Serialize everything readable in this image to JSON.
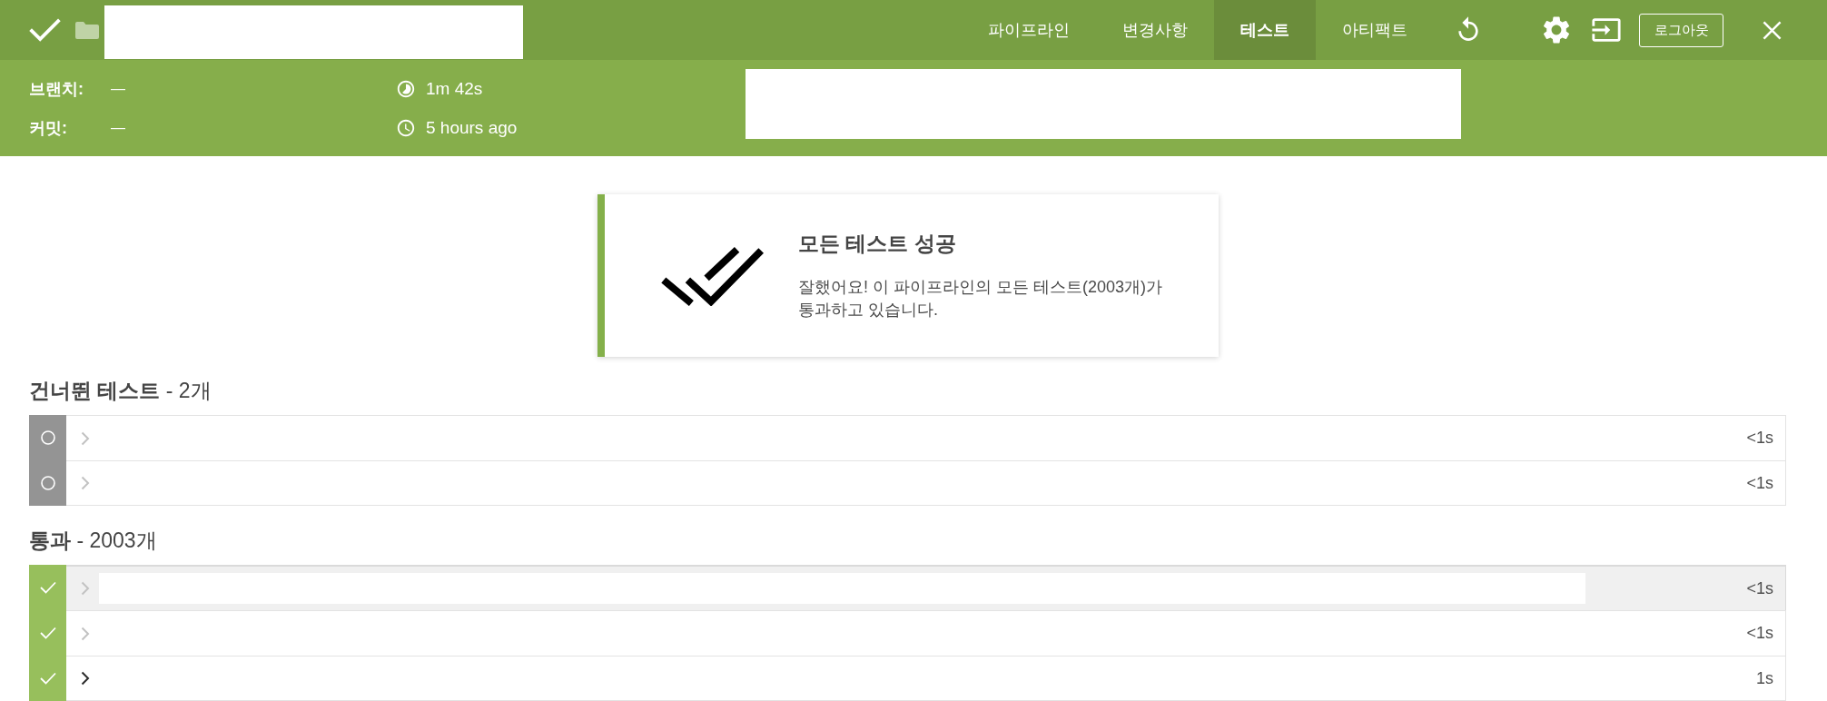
{
  "header": {
    "tabs": [
      {
        "label": "파이프라인",
        "selected": false
      },
      {
        "label": "변경사항",
        "selected": false
      },
      {
        "label": "테스트",
        "selected": true
      },
      {
        "label": "아티팩트",
        "selected": false
      }
    ],
    "logout": "로그아웃"
  },
  "run_info": {
    "branch_label": "브랜치:",
    "branch": "—",
    "commit_label": "커밋:",
    "commit": "—",
    "duration": "1m 42s",
    "started": "5 hours ago"
  },
  "summary": {
    "title": "모든 테스트 성공",
    "message": "잘했어요! 이 파이프라인의 모든 테스트(2003개)가 통과하고 있습니다."
  },
  "sections": [
    {
      "kind": "skipped",
      "heading": "**건너뛴 테스트** - 2개",
      "rows": [
        {
          "duration": "<1s",
          "highlighted": false,
          "expandable": false
        },
        {
          "duration": "<1s",
          "highlighted": false,
          "expandable": false
        }
      ]
    },
    {
      "kind": "passed",
      "heading": "**통과** - 2003개",
      "rows": [
        {
          "duration": "<1s",
          "highlighted": true,
          "expandable": false
        },
        {
          "duration": "<1s",
          "highlighted": false,
          "expandable": false
        },
        {
          "duration": "1s",
          "highlighted": false,
          "expandable": true
        }
      ]
    }
  ]
}
